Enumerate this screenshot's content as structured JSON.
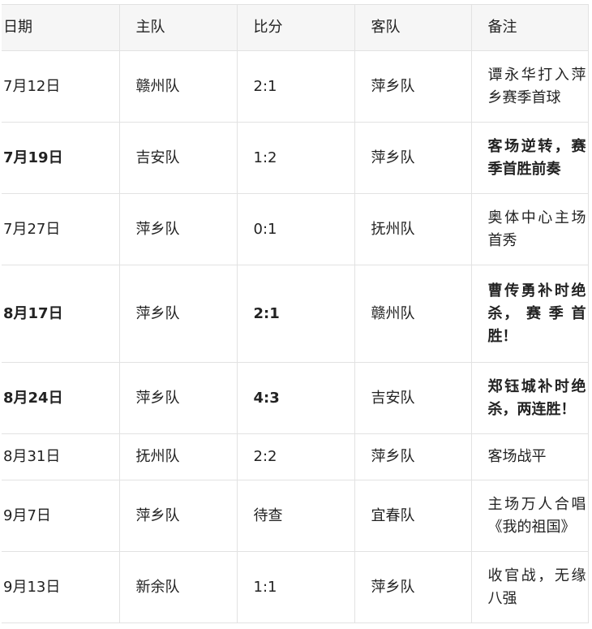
{
  "table": {
    "headers": [
      "日期",
      "主队",
      "比分",
      "客队",
      "备注"
    ],
    "rows": [
      {
        "date": "7月12日",
        "home": "赣州队",
        "score": "2:1",
        "away": "萍乡队",
        "note": "谭永华打入萍乡赛季首球"
      },
      {
        "date": "7月19日",
        "home": "吉安队",
        "score": "1:2",
        "away": "萍乡队",
        "note": "客场逆转，赛季首胜前奏"
      },
      {
        "date": "7月27日",
        "home": "萍乡队",
        "score": "0:1",
        "away": "抚州队",
        "note": "奥体中心主场首秀"
      },
      {
        "date": "8月17日",
        "home": "萍乡队",
        "score": "2:1",
        "away": "赣州队",
        "note": "曹传勇补时绝杀， 赛 季 首胜！"
      },
      {
        "date": "8月24日",
        "home": "萍乡队",
        "score": "4:3",
        "away": "吉安队",
        "note": "郑钰城补时绝杀，两连胜！"
      },
      {
        "date": "8月31日",
        "home": "抚州队",
        "score": "2:2",
        "away": "萍乡队",
        "note": "客场战平"
      },
      {
        "date": "9月7日",
        "home": "萍乡队",
        "score": "待查",
        "away": "宜春队",
        "note": "主场万人合唱《我的祖国》"
      },
      {
        "date": "9月13日",
        "home": "新余队",
        "score": "1:1",
        "away": "萍乡队",
        "note": "收官战，无缘八强"
      }
    ]
  }
}
